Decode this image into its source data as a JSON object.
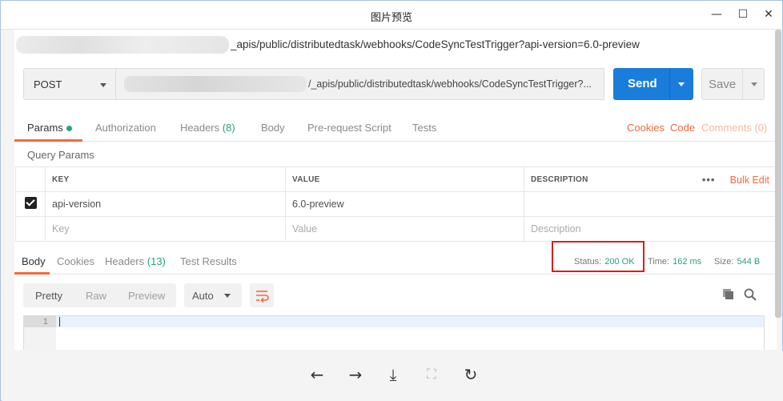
{
  "window": {
    "title": "图片预览",
    "controls": {
      "minimize": "—",
      "maximize": "☐",
      "close": "✕"
    }
  },
  "url_line": "_apis/public/distributedtask/webhooks/CodeSyncTestTrigger?api-version=6.0-preview",
  "request": {
    "method": "POST",
    "url": "/_apis/public/distributedtask/webhooks/CodeSyncTestTrigger?...",
    "send_label": "Send",
    "save_label": "Save"
  },
  "request_tabs": {
    "params": "Params",
    "authorization": "Authorization",
    "headers": "Headers",
    "headers_count": "(8)",
    "body": "Body",
    "prerequest": "Pre-request Script",
    "tests": "Tests",
    "cookies": "Cookies",
    "code": "Code",
    "comments": "Comments (0)"
  },
  "query_params": {
    "label": "Query Params",
    "columns": {
      "key": "KEY",
      "value": "VALUE",
      "description": "DESCRIPTION"
    },
    "more": "•••",
    "bulk_edit": "Bulk Edit",
    "rows": [
      {
        "key": "api-version",
        "value": "6.0-preview",
        "description": "",
        "checked": true
      }
    ],
    "placeholders": {
      "key": "Key",
      "value": "Value",
      "description": "Description"
    }
  },
  "response_tabs": {
    "body": "Body",
    "cookies": "Cookies",
    "headers": "Headers",
    "headers_count": "(13)",
    "test_results": "Test Results"
  },
  "response_status": {
    "status_label": "Status:",
    "status_value": "200 OK",
    "time_label": "Time:",
    "time_value": "162 ms",
    "size_label": "Size:",
    "size_value": "544 B"
  },
  "view_options": {
    "pretty": "Pretty",
    "raw": "Raw",
    "preview": "Preview",
    "format": "Auto"
  },
  "editor": {
    "line_number": "1"
  },
  "bottom_nav": {
    "prev": "←",
    "next": "→",
    "download": "⤓",
    "fit": "⛶",
    "rotate": "↻"
  },
  "colors": {
    "accent": "#f26b3a",
    "primary": "#1a7ddb",
    "success": "#26a47c",
    "highlight": "#e21a1a"
  }
}
